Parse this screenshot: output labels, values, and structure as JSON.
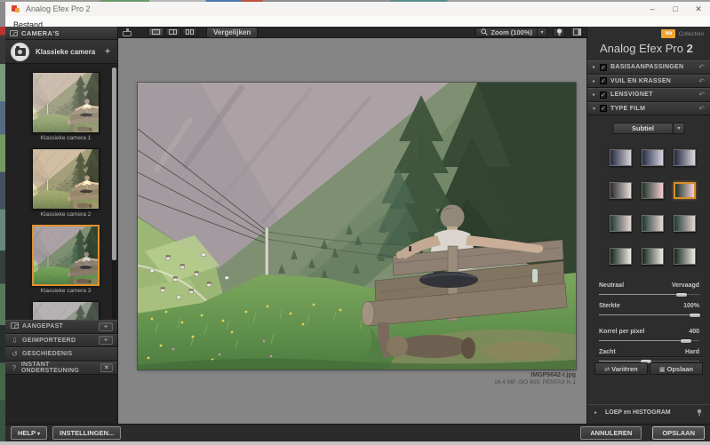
{
  "window": {
    "title": "Analog Efex Pro 2",
    "menu": [
      "Bestand"
    ],
    "minimize": "–",
    "maximize": "□",
    "close": "✕"
  },
  "sidebar": {
    "header": "CAMERA'S",
    "selector": {
      "label": "Klassieke camera",
      "add": "+"
    },
    "thumbnails": [
      {
        "label": "Klassieke camera 1",
        "selected": false
      },
      {
        "label": "Klassieke camera 2",
        "selected": false
      },
      {
        "label": "Klassieke camera 3",
        "selected": true
      }
    ],
    "panels": [
      {
        "label": "AANGEPAST",
        "icon": "camera-icon",
        "action": "+"
      },
      {
        "label": "GEIMPORTEERD",
        "icon": "import-icon",
        "action": "+"
      },
      {
        "label": "GESCHIEDENIS",
        "icon": "history-icon",
        "action": ""
      },
      {
        "label": "INSTANT ONDERSTEUNING",
        "icon": "question-icon",
        "action": "✕"
      }
    ],
    "help": "HELP",
    "settings": "INSTELLINGEN..."
  },
  "toolbar": {
    "compare": "Vergelijken",
    "zoom": "Zoom (100%)"
  },
  "canvas": {
    "filename": "IMGP9642-r.jpg",
    "fileinfo": "16.4 MP, ISO 800, PENTAX K-1"
  },
  "rightpanel": {
    "logo": "Nik",
    "collection": "Collection",
    "title": "Analog Efex Pro",
    "title_number": "2",
    "sections": [
      {
        "label": "BASISAANPASSINGEN",
        "expanded": false
      },
      {
        "label": "VUIL EN KRASSEN",
        "expanded": false
      },
      {
        "label": "LENSVIGNET",
        "expanded": false
      },
      {
        "label": "TYPE FILM",
        "expanded": true
      }
    ],
    "preset": "Subtiel",
    "film_grid": {
      "rows": [
        {
          "items": [
            {
              "n": "1",
              "from": "#232a42",
              "to": "#d9d2da",
              "selected": false
            },
            {
              "n": "2",
              "from": "#262e48",
              "to": "#d8d3de",
              "selected": false
            },
            {
              "n": "3",
              "from": "#20283e",
              "to": "#ded8e0",
              "selected": false
            }
          ]
        },
        {
          "items": [
            {
              "n": "1",
              "from": "#2b2b2b",
              "to": "#e6dfdb",
              "selected": false
            },
            {
              "n": "2",
              "from": "#1e3429",
              "to": "#f2cdd2",
              "selected": false
            },
            {
              "n": "3",
              "from": "#1c3528",
              "to": "#f4ced6",
              "selected": true
            }
          ]
        },
        {
          "items": [
            {
              "n": "1",
              "from": "#223c36",
              "to": "#e9d6d6",
              "selected": false
            },
            {
              "n": "2",
              "from": "#1f3a33",
              "to": "#ead8d6",
              "selected": false
            },
            {
              "n": "3",
              "from": "#213b34",
              "to": "#e7d5d3",
              "selected": false
            }
          ]
        },
        {
          "items": [
            {
              "n": "1",
              "from": "#16251b",
              "to": "#efece7",
              "selected": false
            },
            {
              "n": "2",
              "from": "#17271c",
              "to": "#f0ede9",
              "selected": false
            },
            {
              "n": "3",
              "from": "#15241a",
              "to": "#eeebe6",
              "selected": false
            }
          ]
        }
      ]
    },
    "sliders": [
      {
        "left": "Neutraal",
        "right": "Vervaagd",
        "pos": 82,
        "gap": false
      },
      {
        "left": "Sterkte",
        "right": "100%",
        "pos": 96,
        "gap": false
      },
      {
        "left": "Korrel per pixel",
        "right": "400",
        "pos": 87,
        "gap": true
      },
      {
        "left": "Zacht",
        "right": "Hard",
        "pos": 47,
        "gap": false
      }
    ],
    "vary": "Variëren",
    "save": "Opslaan",
    "loupe": "LOEP en HISTOGRAM"
  },
  "footer": {
    "cancel": "ANNULEREN",
    "save": "OPSLAAN"
  },
  "colors": {
    "accent": "#e0912f",
    "nik_orange": "#f0a32e"
  }
}
